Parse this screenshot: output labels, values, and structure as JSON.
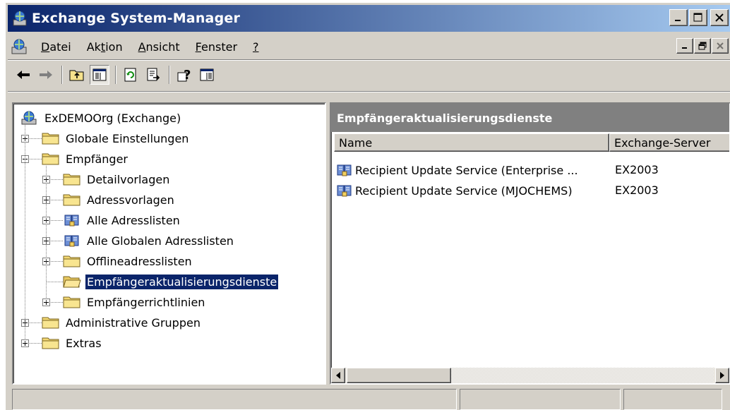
{
  "window": {
    "title": "Exchange System-Manager",
    "title_bar_color": "#0a246a"
  },
  "menubar": {
    "items": [
      {
        "label": "Datei",
        "accel": "D"
      },
      {
        "label": "Aktion",
        "accel": "t"
      },
      {
        "label": "Ansicht",
        "accel": "A"
      },
      {
        "label": "Fenster",
        "accel": "F"
      },
      {
        "label": "?",
        "accel": "?"
      }
    ]
  },
  "toolbar": {
    "buttons": [
      {
        "name": "back-arrow-icon"
      },
      {
        "name": "forward-arrow-icon"
      },
      {
        "name": "up-folder-icon"
      },
      {
        "name": "show-hide-tree-icon"
      },
      {
        "name": "refresh-icon"
      },
      {
        "name": "export-list-icon"
      },
      {
        "name": "help-icon"
      },
      {
        "name": "action-pane-icon"
      }
    ]
  },
  "tree": {
    "nodes": [
      {
        "label": "ExDEMOOrg (Exchange)",
        "level": 0,
        "icon": "exchange-org-icon",
        "expander": "none"
      },
      {
        "label": "Globale Einstellungen",
        "level": 1,
        "icon": "folder-icon",
        "expander": "plus"
      },
      {
        "label": "Empfänger",
        "level": 1,
        "icon": "folder-icon",
        "expander": "minus"
      },
      {
        "label": "Detailvorlagen",
        "level": 2,
        "icon": "folder-icon",
        "expander": "plus"
      },
      {
        "label": "Adressvorlagen",
        "level": 2,
        "icon": "folder-icon",
        "expander": "plus"
      },
      {
        "label": "Alle Adresslisten",
        "level": 2,
        "icon": "address-list-icon",
        "expander": "plus"
      },
      {
        "label": "Alle Globalen Adresslisten",
        "level": 2,
        "icon": "address-list-icon",
        "expander": "plus"
      },
      {
        "label": "Offlineadresslisten",
        "level": 2,
        "icon": "folder-icon",
        "expander": "plus"
      },
      {
        "label": "Empfängeraktualisierungsdienste",
        "level": 2,
        "icon": "open-folder-icon",
        "expander": "none",
        "selected": true
      },
      {
        "label": "Empfängerrichtlinien",
        "level": 2,
        "icon": "folder-icon",
        "expander": "plus"
      },
      {
        "label": "Administrative Gruppen",
        "level": 1,
        "icon": "folder-icon",
        "expander": "plus"
      },
      {
        "label": "Extras",
        "level": 1,
        "icon": "folder-icon",
        "expander": "plus"
      }
    ]
  },
  "details": {
    "header": "Empfängeraktualisierungsdienste",
    "columns": [
      "Name",
      "Exchange-Server"
    ],
    "rows": [
      {
        "name": "Recipient Update Service (Enterprise ...",
        "server": "EX2003",
        "icon": "recipient-update-service-icon"
      },
      {
        "name": "Recipient Update Service (MJOCHEMS)",
        "server": "EX2003",
        "icon": "recipient-update-service-icon"
      }
    ]
  },
  "statusbar": {
    "panels": [
      "",
      "",
      ""
    ]
  }
}
